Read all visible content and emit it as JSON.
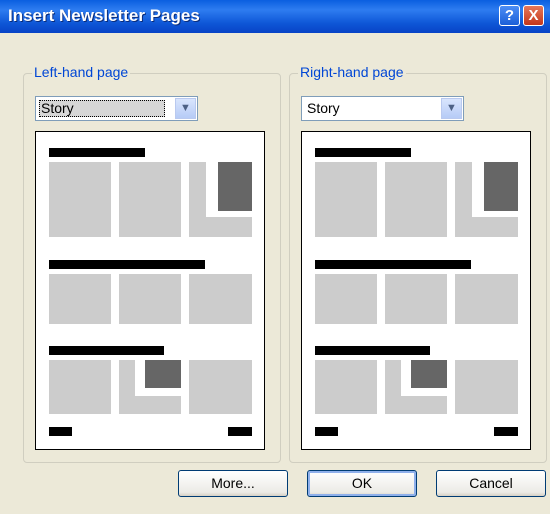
{
  "window": {
    "title": "Insert Newsletter Pages",
    "help_glyph": "?",
    "close_glyph": "X"
  },
  "left_group": {
    "label": "Left-hand page",
    "selected": "Story"
  },
  "right_group": {
    "label": "Right-hand page",
    "selected": "Story"
  },
  "buttons": {
    "more": "More...",
    "ok": "OK",
    "cancel": "Cancel"
  },
  "colors": {
    "dialog_bg": "#ECE9D8",
    "title_bar": "#0A5FE0",
    "group_label": "#0046D5",
    "preview_cell": "#CCCCCC",
    "preview_image": "#666666"
  },
  "icons": {
    "dropdown": "chevron-down-icon"
  }
}
